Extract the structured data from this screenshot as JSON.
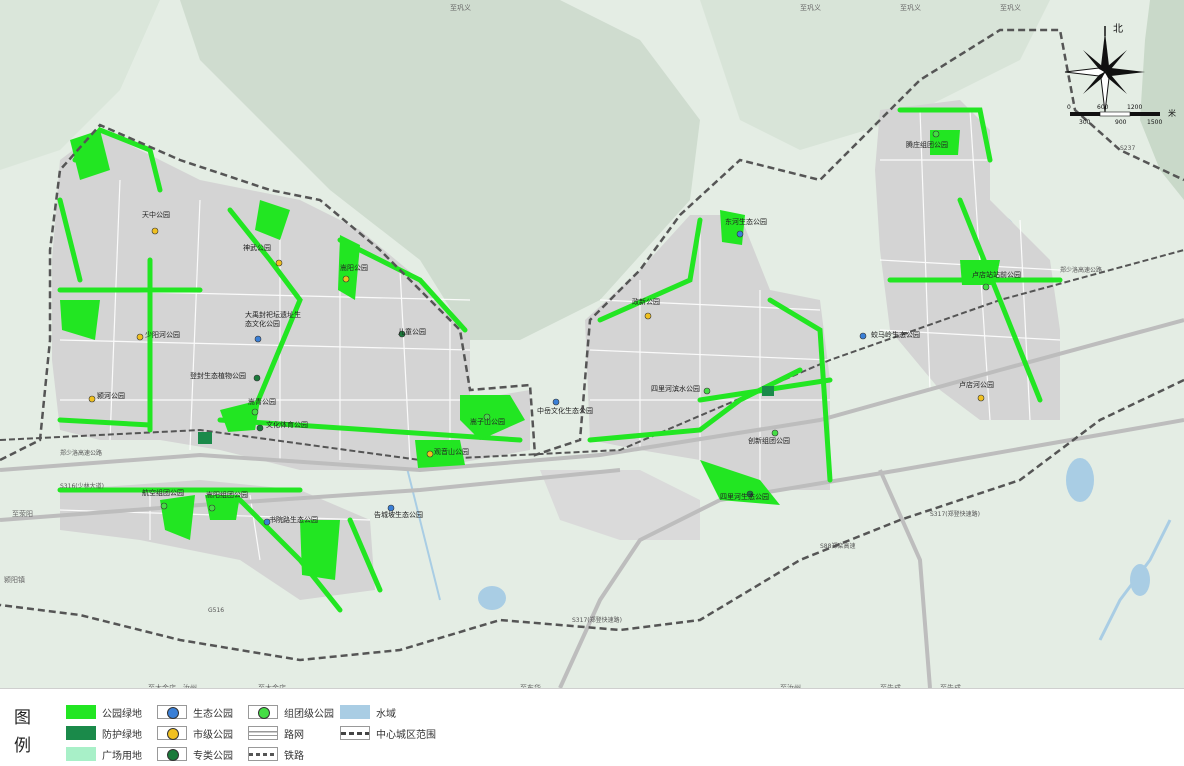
{
  "map": {
    "edge_labels": [
      "至荥阳",
      "至巩义",
      "至巩义",
      "至巩义",
      "至巩义",
      "至大金店、汝州",
      "至大金店",
      "至东华",
      "至汝州",
      "至告成",
      "至告成",
      "颍阳镇"
    ],
    "road_labels": [
      "郑少洛高速公路",
      "S316(少林大道)",
      "郑少洛高速公路",
      "S317(郑登快速路)",
      "S317(郑登快速路)",
      "S88郑栾高速",
      "G516",
      "S237"
    ],
    "parks_municipal": [
      "天中公园",
      "神武公园",
      "嵩阳公园",
      "少阳河公园",
      "颍河公园",
      "观音山公园",
      "政新公园",
      "卢店站站前公园"
    ],
    "parks_ecological": [
      "大禹封祀坛遗址生态文化公园",
      "中岳文化生态公园",
      "东河生态公园",
      "蛟马岭生态公园",
      "书院路生态公园",
      "告城坡生态公园"
    ],
    "parks_group": [
      "腾庄组团公园",
      "卢店站站前公园",
      "少室公园",
      "嵩阳组团公园",
      "航空组团公园",
      "四里河生态公园",
      "创新组团公园"
    ],
    "parks_special": [
      "儿童公园",
      "登封生态植物公园",
      "文化体育公园",
      "四里河生态公园"
    ],
    "labels": [
      {
        "text": "天中公园",
        "kind": "municipal"
      },
      {
        "text": "神武公园",
        "kind": "municipal"
      },
      {
        "text": "嵩阳公园",
        "kind": "municipal"
      },
      {
        "text": "大禹封祀坛遗址生",
        "kind": "ecological"
      },
      {
        "text": "态文化公园",
        "kind": "none"
      },
      {
        "text": "少阳河公园",
        "kind": "municipal"
      },
      {
        "text": "儿童公园",
        "kind": "special"
      },
      {
        "text": "登封生态植物公园",
        "kind": "special"
      },
      {
        "text": "颍河公园",
        "kind": "municipal"
      },
      {
        "text": "嵩青公园",
        "kind": "group"
      },
      {
        "text": "文化体育公园",
        "kind": "special"
      },
      {
        "text": "嵩子山公园",
        "kind": "group"
      },
      {
        "text": "观音山公园",
        "kind": "municipal"
      },
      {
        "text": "中岳文化生态公园",
        "kind": "ecological"
      },
      {
        "text": "东河生态公园",
        "kind": "ecological"
      },
      {
        "text": "政新公园",
        "kind": "municipal"
      },
      {
        "text": "四里河滨水公园",
        "kind": "group"
      },
      {
        "text": "创新组团公园",
        "kind": "group"
      },
      {
        "text": "四里河生态公园",
        "kind": "special"
      },
      {
        "text": "蛟马岭生态公园",
        "kind": "ecological"
      },
      {
        "text": "腾庄组团公园",
        "kind": "group"
      },
      {
        "text": "卢店站站前公园",
        "kind": "group"
      },
      {
        "text": "卢店河公园",
        "kind": "municipal"
      },
      {
        "text": "航空组团公园",
        "kind": "group"
      },
      {
        "text": "嵩阳组团公园",
        "kind": "group"
      },
      {
        "text": "书院路生态公园",
        "kind": "ecological"
      },
      {
        "text": "告城坡生态公园",
        "kind": "ecological"
      }
    ]
  },
  "compass": {
    "north_label": "北"
  },
  "scale": {
    "unit": "米",
    "ticks": [
      "0",
      "300",
      "600",
      "900",
      "1200",
      "1500"
    ]
  },
  "legend": {
    "title_1": "图",
    "title_2": "例",
    "items": [
      {
        "label": "公园绿地",
        "type": "fill",
        "color": "#22e622"
      },
      {
        "label": "防护绿地",
        "type": "fill",
        "color": "#1a8a4a"
      },
      {
        "label": "广场用地",
        "type": "fill",
        "color": "#a8f0c8"
      },
      {
        "label": "生态公园",
        "type": "dot",
        "color": "#3a7fd6"
      },
      {
        "label": "市级公园",
        "type": "dot",
        "color": "#f0c020"
      },
      {
        "label": "专类公园",
        "type": "dot",
        "color": "#1a7a3a"
      },
      {
        "label": "组团级公园",
        "type": "dot",
        "color": "#44dd44"
      },
      {
        "label": "路网",
        "type": "road"
      },
      {
        "label": "铁路",
        "type": "rail"
      },
      {
        "label": "水域",
        "type": "fill",
        "color": "#a9cde4"
      },
      {
        "label": "中心城区范围",
        "type": "boundary"
      }
    ]
  },
  "colors": {
    "terrain": "#e4ede4",
    "mountain": "#cfdccf",
    "urban": "#d4d4d4",
    "park": "#22e622",
    "protective": "#1a8a4a",
    "water": "#a9cde4",
    "boundary": "#555555"
  }
}
